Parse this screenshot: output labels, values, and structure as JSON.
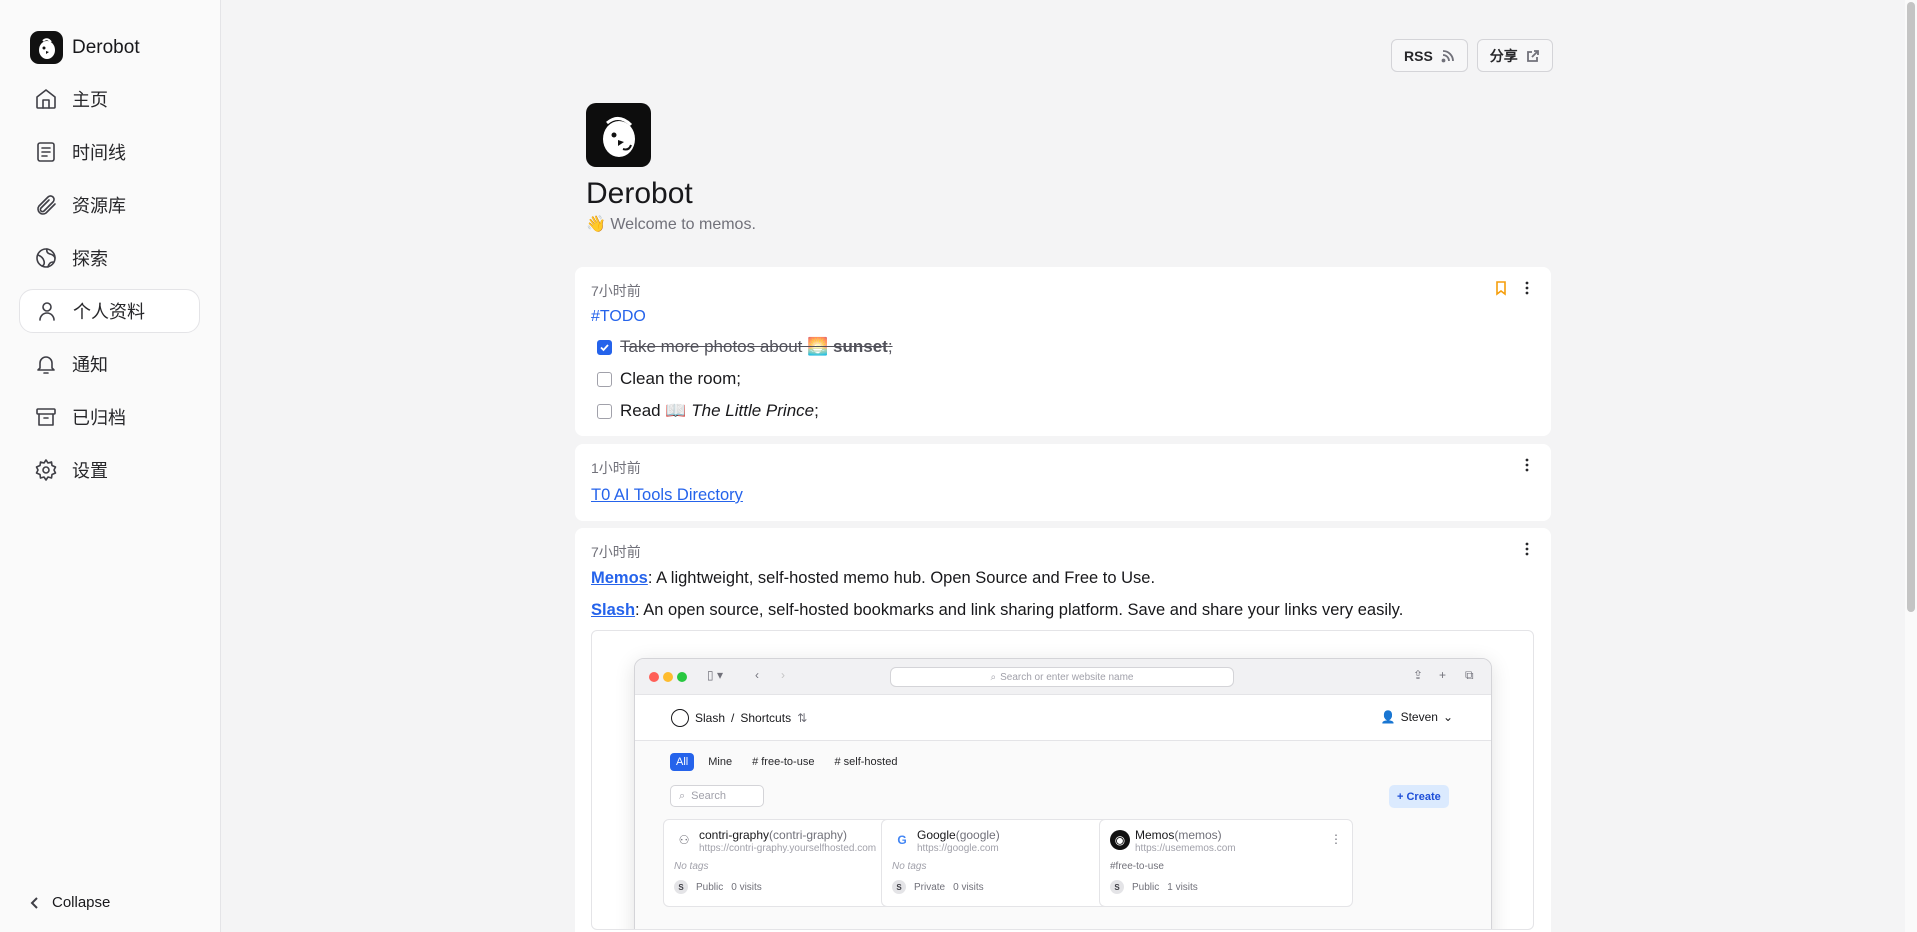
{
  "sidebar": {
    "brand": "Derobot",
    "items": [
      {
        "label": "主页",
        "icon": "home-icon"
      },
      {
        "label": "时间线",
        "icon": "timeline-icon"
      },
      {
        "label": "资源库",
        "icon": "paperclip-icon"
      },
      {
        "label": "探索",
        "icon": "globe-icon"
      },
      {
        "label": "个人资料",
        "icon": "user-icon",
        "active": true
      },
      {
        "label": "通知",
        "icon": "bell-icon"
      },
      {
        "label": "已归档",
        "icon": "archive-icon"
      },
      {
        "label": "设置",
        "icon": "gear-icon"
      }
    ],
    "collapse_label": "Collapse"
  },
  "header": {
    "rss_label": "RSS",
    "share_label": "分享"
  },
  "profile": {
    "name": "Derobot",
    "description": "👋 Welcome to memos."
  },
  "memos": [
    {
      "time": "7小时前",
      "tag": "#TODO",
      "tasks": [
        {
          "text_a": "Take more photos about 🌅 ",
          "text_b": "sunset",
          "text_c": ";",
          "checked": true
        },
        {
          "text": "Clean the room;",
          "checked": false
        },
        {
          "text_a": "Read 📖 ",
          "text_b": "The Little Prince",
          "text_c": ";",
          "checked": false
        }
      ]
    },
    {
      "time": "1小时前",
      "link": "T0 AI Tools Directory"
    },
    {
      "time": "7小时前",
      "lines": [
        {
          "name": "Memos",
          "text": ": A lightweight, self-hosted memo hub. Open Source and Free to Use."
        },
        {
          "name": "Slash",
          "text": ": An open source, self-hosted bookmarks and link sharing platform. Save and share your links very easily."
        }
      ],
      "embed": {
        "url_placeholder": "Search or enter website name",
        "crumb_app": "Slash",
        "crumb_sep": "/",
        "crumb_page": "Shortcuts",
        "user": "Steven",
        "filters": [
          "All",
          "Mine",
          "# free-to-use",
          "# self-hosted"
        ],
        "search_placeholder": "Search",
        "create_label": "+ Create",
        "shortcuts": [
          {
            "title": "contri-graphy",
            "alias": "(contri-graphy)",
            "url": "https://contri-graphy.yourselfhosted.com",
            "tags": "No tags",
            "visibility": "Public",
            "visits": "0 visits",
            "initial": "S"
          },
          {
            "title": "Google",
            "alias": "(google)",
            "url": "https://google.com",
            "tags": "No tags",
            "visibility": "Private",
            "visits": "0 visits",
            "initial": "S"
          },
          {
            "title": "Memos",
            "alias": "(memos)",
            "url": "https://usememos.com",
            "tags": "#free-to-use",
            "visibility": "Public",
            "visits": "1 visits",
            "initial": "S"
          }
        ]
      }
    }
  ],
  "colors": {
    "accent": "#2563eb",
    "bookmark": "#f59e0b",
    "background": "#f4f4f5"
  }
}
